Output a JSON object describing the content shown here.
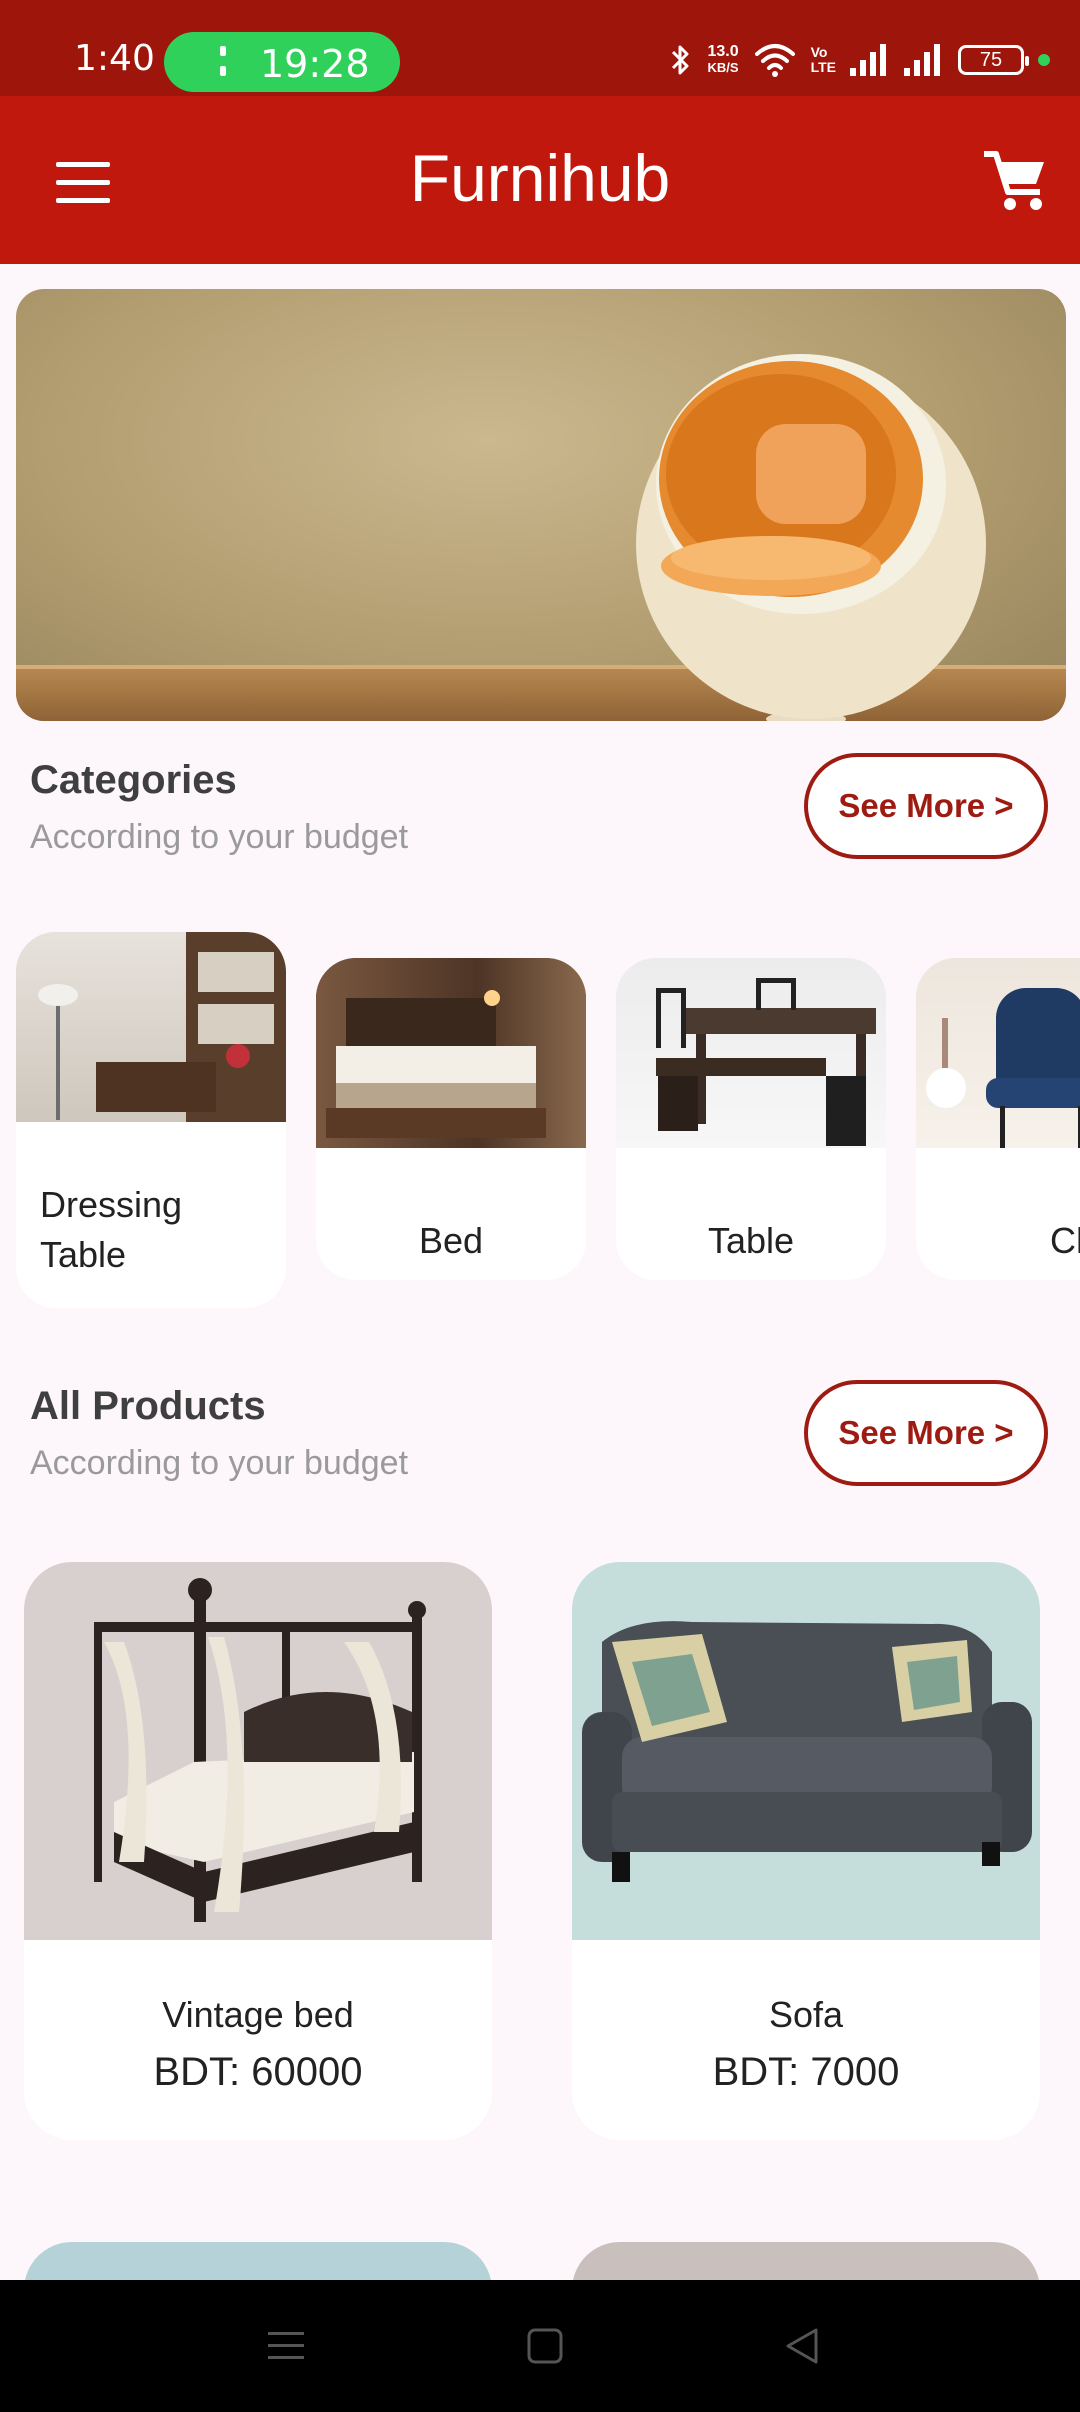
{
  "status_bar": {
    "time": "1:40",
    "call_timer": "19:28",
    "net_speed_value": "13.0",
    "net_speed_unit": "KB/S",
    "volte_top": "Vo",
    "volte_bottom": "LTE",
    "battery_level": "75",
    "icons": [
      "bluetooth-icon",
      "wifi-icon",
      "signal-icon",
      "battery-icon"
    ]
  },
  "app_bar": {
    "title": "Furnihub",
    "menu_icon": "hamburger-menu-icon",
    "cart_icon": "shopping-cart-icon"
  },
  "categories_section": {
    "title": "Categories",
    "subtitle": "According to your budget",
    "see_more_label": "See More >",
    "items": [
      {
        "label": "Dressing Table"
      },
      {
        "label": "Bed"
      },
      {
        "label": "Table"
      },
      {
        "label": "Chai"
      }
    ]
  },
  "products_section": {
    "title": "All Products",
    "subtitle": "According to your budget",
    "see_more_label": "See More >",
    "items": [
      {
        "name": "Vintage bed",
        "price": "BDT: 60000"
      },
      {
        "name": "Sofa",
        "price": "BDT: 7000"
      }
    ]
  },
  "colors": {
    "status_bar": "#9e150c",
    "app_bar": "#c0180c",
    "accent": "#9e1b12",
    "call_pill": "#2fd15a",
    "background": "#fdf7fb"
  },
  "nav_bar": {
    "icons": [
      "recents-icon",
      "home-icon",
      "back-icon"
    ]
  }
}
